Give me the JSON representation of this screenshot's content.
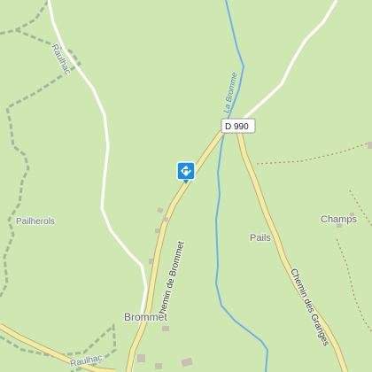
{
  "map": {
    "colors": {
      "background": "#cfe8b2",
      "forest": "#c6e3a6",
      "road_minor": "#ffffff",
      "road_secondary": "#f5eca4",
      "road_casing": "#b8b07a",
      "river": "#6fb1e6",
      "boundary": "#8aa38a",
      "path": "#b08a6a",
      "poi_marker": "#1a8fe0"
    },
    "labels": {
      "commune_top": "Raulhac",
      "commune_bottom": "Raulhac",
      "hamlet_pailherols": "Pailherols",
      "river": "La Bromme",
      "road_shield": "D 990",
      "road_chemin_brommet": "Chemin de Brommet",
      "road_chemin_granges": "Chemin des Granges",
      "place_champs": "Champs",
      "place_pails": "Pails",
      "place_brommet": "Brommet"
    },
    "icons": {
      "directions_marker": "directions-icon"
    }
  }
}
